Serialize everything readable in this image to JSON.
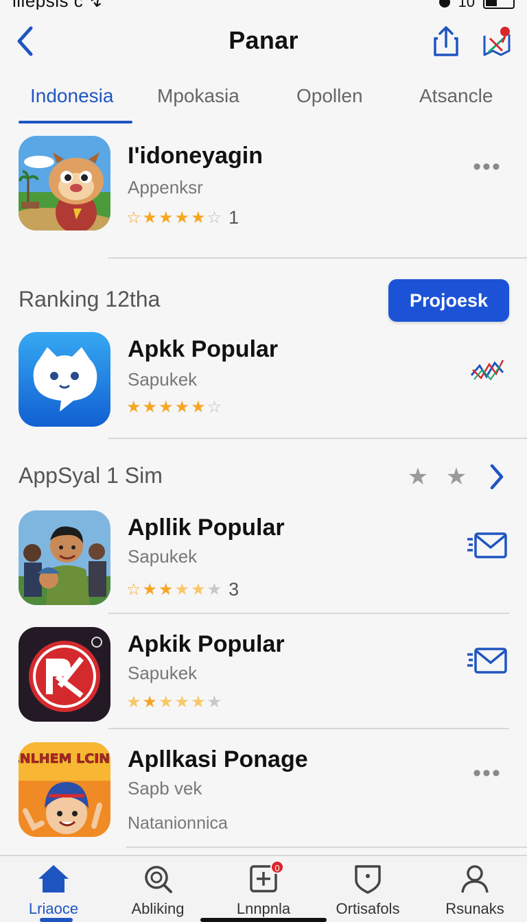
{
  "status_bar": {
    "left_text": "iiiepsis c ↯",
    "right_text": "10"
  },
  "nav": {
    "title": "Panar"
  },
  "tabs": [
    {
      "label": "Indonesia",
      "active": true
    },
    {
      "label": "Mpokasia",
      "active": false
    },
    {
      "label": "Opollen",
      "active": false
    },
    {
      "label": "Atsancle",
      "active": false
    }
  ],
  "featured": {
    "title": "I'idoneyagin",
    "subtitle": "Appenksr",
    "rating": 4.5,
    "stars": [
      "outline",
      "full",
      "full",
      "full",
      "full",
      "outline-gray"
    ],
    "rating_count": "1"
  },
  "section_ranking": {
    "heading": "Ranking 12tha",
    "button_label": "Projoesk"
  },
  "ranking_app": {
    "title": "Apkk Popular",
    "subtitle": "Sapukek",
    "rating": 4.5,
    "stars": [
      "full",
      "full",
      "full",
      "full",
      "full",
      "outline-gray"
    ]
  },
  "section_apps": {
    "heading": "AppSyal 1 Sim"
  },
  "apps": [
    {
      "title": "Apllik Popular",
      "subtitle": "Sapukek",
      "rating": 3,
      "stars": [
        "outline",
        "full",
        "full",
        "half",
        "half",
        "empty"
      ],
      "rating_count": "3"
    },
    {
      "title": "Apkik Popular",
      "subtitle": "Sapukek",
      "rating": 3,
      "stars": [
        "half",
        "full",
        "half",
        "half",
        "half",
        "empty"
      ]
    },
    {
      "title": "Apllkasi Ponage",
      "subtitle": "Sapb vek",
      "extra": "Natanionnica",
      "icon_text": "CNLHEM LCINE"
    }
  ],
  "tab_bar": [
    {
      "label": "Lriaoce",
      "icon": "home-icon",
      "active": true
    },
    {
      "label": "Abliking",
      "icon": "search-icon",
      "active": false
    },
    {
      "label": "Lnnpnla",
      "icon": "add-box-icon",
      "active": false,
      "badge": "0"
    },
    {
      "label": "Ortisafols",
      "icon": "shield-icon",
      "active": false
    },
    {
      "label": "Rsunaks",
      "icon": "person-icon",
      "active": false
    }
  ],
  "colors": {
    "accent": "#1f55c0",
    "button": "#1c53d6",
    "star": "#f5a623",
    "badge": "#d9262c"
  }
}
